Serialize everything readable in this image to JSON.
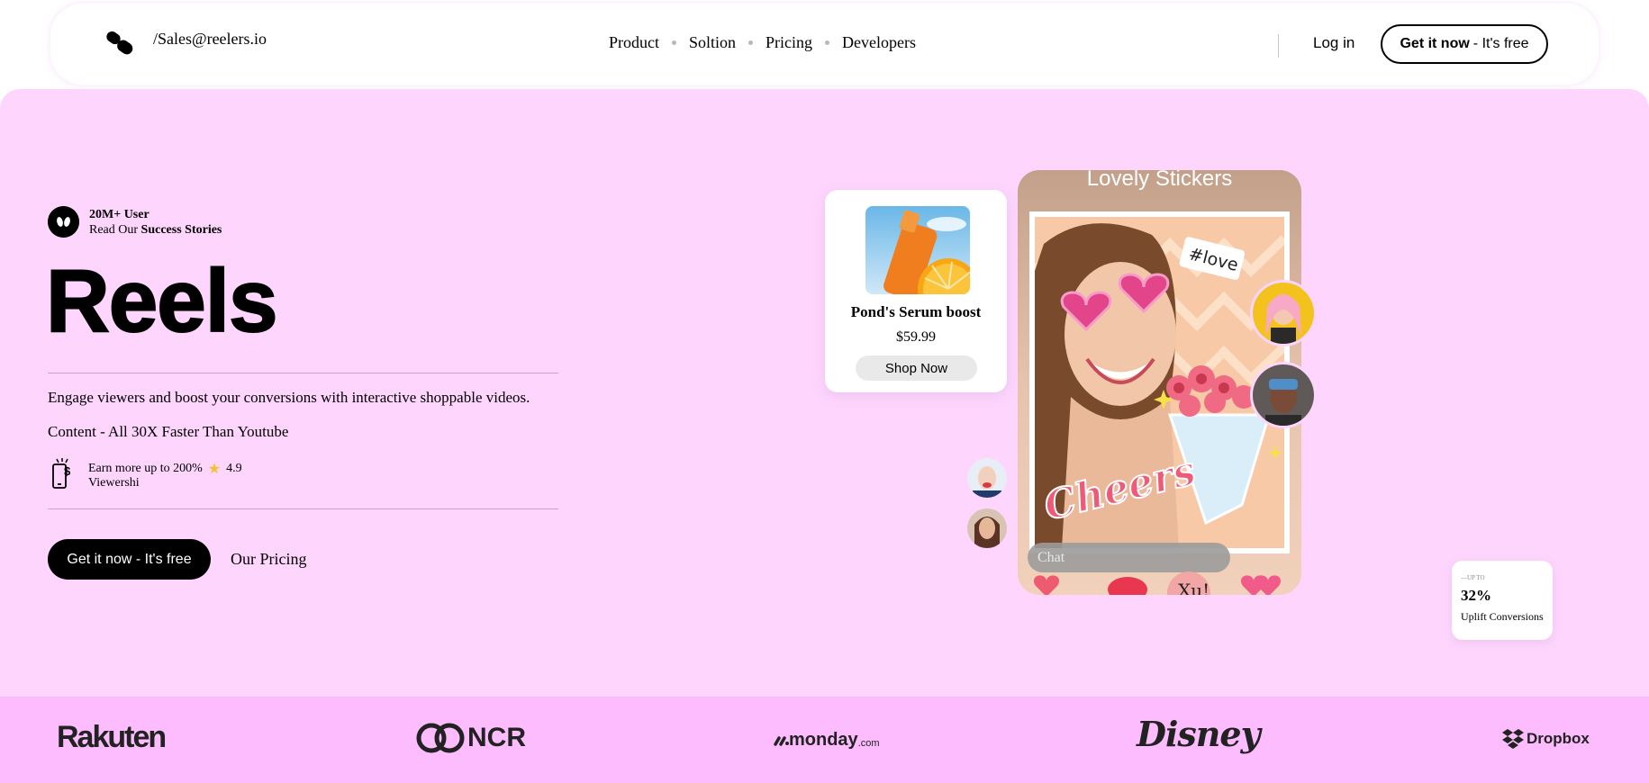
{
  "header": {
    "email": "/Sales@reelers.io",
    "nav": [
      "Product",
      "Soltion",
      "Pricing",
      "Developers"
    ],
    "login": "Log in",
    "cta_bold": "Get it now",
    "cta_rest": "- It's free"
  },
  "hero": {
    "badge_line1": "20M+ User",
    "badge_line2_prefix": "Read Our ",
    "badge_line2_bold": "Success Stories",
    "title": "Reels",
    "description_line1": "Engage viewers and boost your conversions with interactive shoppable videos.",
    "description_line2": "Content - All 30X Faster Than Youtube",
    "earn_text": "Earn more up to 200%",
    "rating": "4.9",
    "earn_line2": "Viewershi",
    "cta": "Get it now - It's free",
    "pricing_link": "Our Pricing"
  },
  "product_card": {
    "name": "Pond's Serum boost",
    "price": "$59.99",
    "button": "Shop Now"
  },
  "phone": {
    "title": "Lovely Stickers",
    "chat_placeholder": "Chat",
    "stickers": [
      "#love",
      "Cheers"
    ]
  },
  "uplift": {
    "label_small": "—UP TO",
    "value": "32%",
    "label": "Uplift Conversions"
  },
  "brands": [
    "Rakuten",
    "NCR",
    "monday",
    ".com",
    "Disney",
    "Dropbox"
  ],
  "colors": {
    "hero_bg": "#fdd5fd",
    "strip_bg": "#fdbcfd",
    "accent_pink": "#e8457a"
  }
}
